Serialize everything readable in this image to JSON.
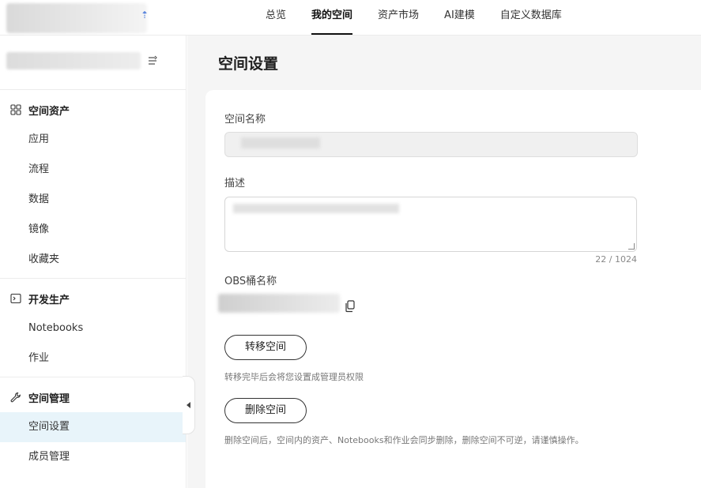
{
  "nav": {
    "items": [
      {
        "label": "总览"
      },
      {
        "label": "我的空间",
        "active": true
      },
      {
        "label": "资产市场"
      },
      {
        "label": "AI建模"
      },
      {
        "label": "自定义数据库"
      }
    ]
  },
  "sidebar": {
    "groups": [
      {
        "title": "空间资产",
        "icon": "grid-icon",
        "items": [
          "应用",
          "流程",
          "数据",
          "镜像",
          "收藏夹"
        ]
      },
      {
        "title": "开发生产",
        "icon": "terminal-icon",
        "items": [
          "Notebooks",
          "作业"
        ]
      },
      {
        "title": "空间管理",
        "icon": "wrench-icon",
        "items": [
          "空间设置",
          "成员管理"
        ],
        "active_item": "空间设置"
      }
    ]
  },
  "main": {
    "title": "空间设置",
    "name_label": "空间名称",
    "desc_label": "描述",
    "desc_counter": "22 / 1024",
    "obs_label": "OBS桶名称",
    "transfer_button": "转移空间",
    "transfer_hint": "转移完毕后会将您设置成管理员权限",
    "delete_button": "删除空间",
    "delete_hint": "删除空间后，空间内的资产、Notebooks和作业会同步删除，删除空间不可逆，请谨慎操作。"
  },
  "colors": {
    "active_menu_bg": "#e8f4fa",
    "content_bg": "#f5f5f5"
  }
}
